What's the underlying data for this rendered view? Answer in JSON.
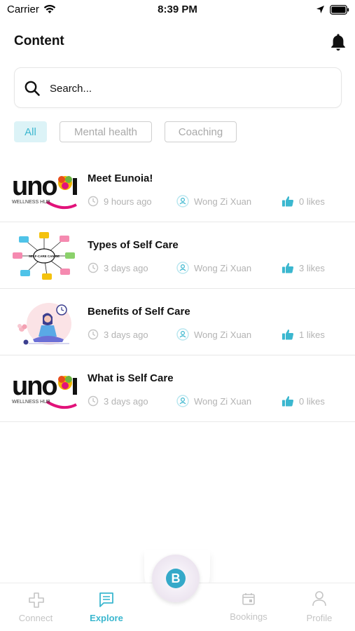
{
  "status_bar": {
    "carrier": "Carrier",
    "time": "8:39 PM"
  },
  "header": {
    "title": "Content"
  },
  "search": {
    "placeholder": "Search..."
  },
  "filters": [
    {
      "label": "All",
      "selected": true
    },
    {
      "label": "Mental health",
      "selected": false
    },
    {
      "label": "Coaching",
      "selected": false
    }
  ],
  "articles": [
    {
      "title": "Meet Eunoia!",
      "time": "9 hours ago",
      "author": "Wong Zi Xuan",
      "likes": "0 likes",
      "thumbnail": "eunoia-logo",
      "logo_caption": "WELLNESS HUB"
    },
    {
      "title": "Types of Self Care",
      "time": "3 days ago",
      "author": "Wong Zi Xuan",
      "likes": "3 likes",
      "thumbnail": "self-care-mindmap",
      "mindmap_center": "SELF-CARE CAN BE"
    },
    {
      "title": "Benefits of Self Care",
      "time": "3 days ago",
      "author": "Wong Zi Xuan",
      "likes": "1 likes",
      "thumbnail": "meditation-illustration"
    },
    {
      "title": "What is Self Care",
      "time": "3 days ago",
      "author": "Wong Zi Xuan",
      "likes": "0 likes",
      "thumbnail": "eunoia-logo",
      "logo_caption": "WELLNESS HUB"
    }
  ],
  "bottom_nav": {
    "connect": "Connect",
    "explore": "Explore",
    "bookings": "Bookings",
    "profile": "Profile",
    "center_logo": "B"
  },
  "colors": {
    "accent": "#3bb7cf",
    "chip_bg": "#dcf3f7",
    "muted": "#b3b3b3",
    "magenta": "#e2127a"
  }
}
